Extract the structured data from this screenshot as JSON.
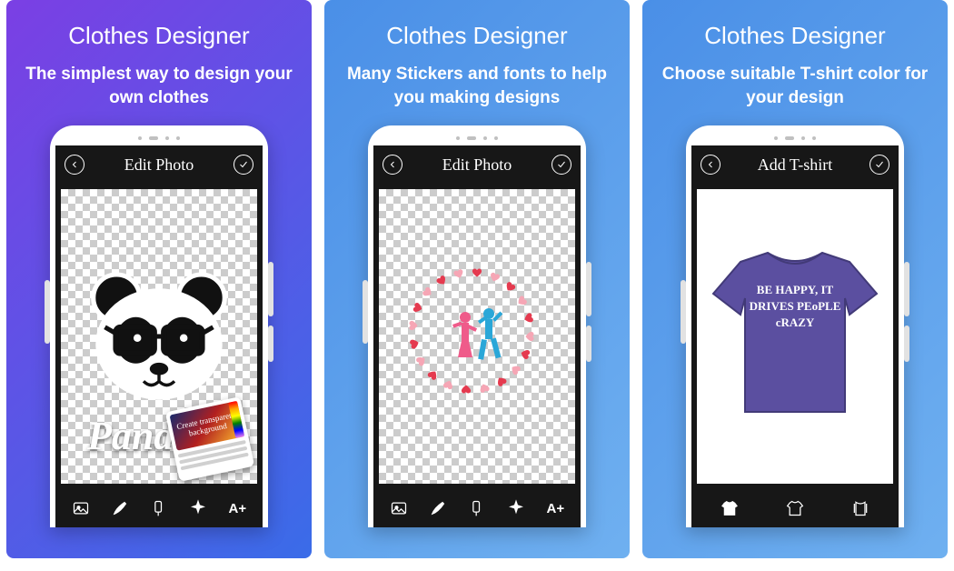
{
  "panels": [
    {
      "title": "Clothes Designer",
      "subtitle": "The simplest way to design your own clothes",
      "app_header": "Edit Photo",
      "design_text": "Panda",
      "badge_text": "Create transparent background"
    },
    {
      "title": "Clothes Designer",
      "subtitle": "Many Stickers and fonts to help you making designs",
      "app_header": "Edit Photo"
    },
    {
      "title": "Clothes Designer",
      "subtitle": "Choose suitable T-shirt color for your design",
      "app_header": "Add T-shirt",
      "tshirt_text": "BE HAPPY, IT DRIVES PEoPLE cRAZY",
      "tshirt_color": "#5b4fa0"
    }
  ],
  "tool_text_label": "A+"
}
